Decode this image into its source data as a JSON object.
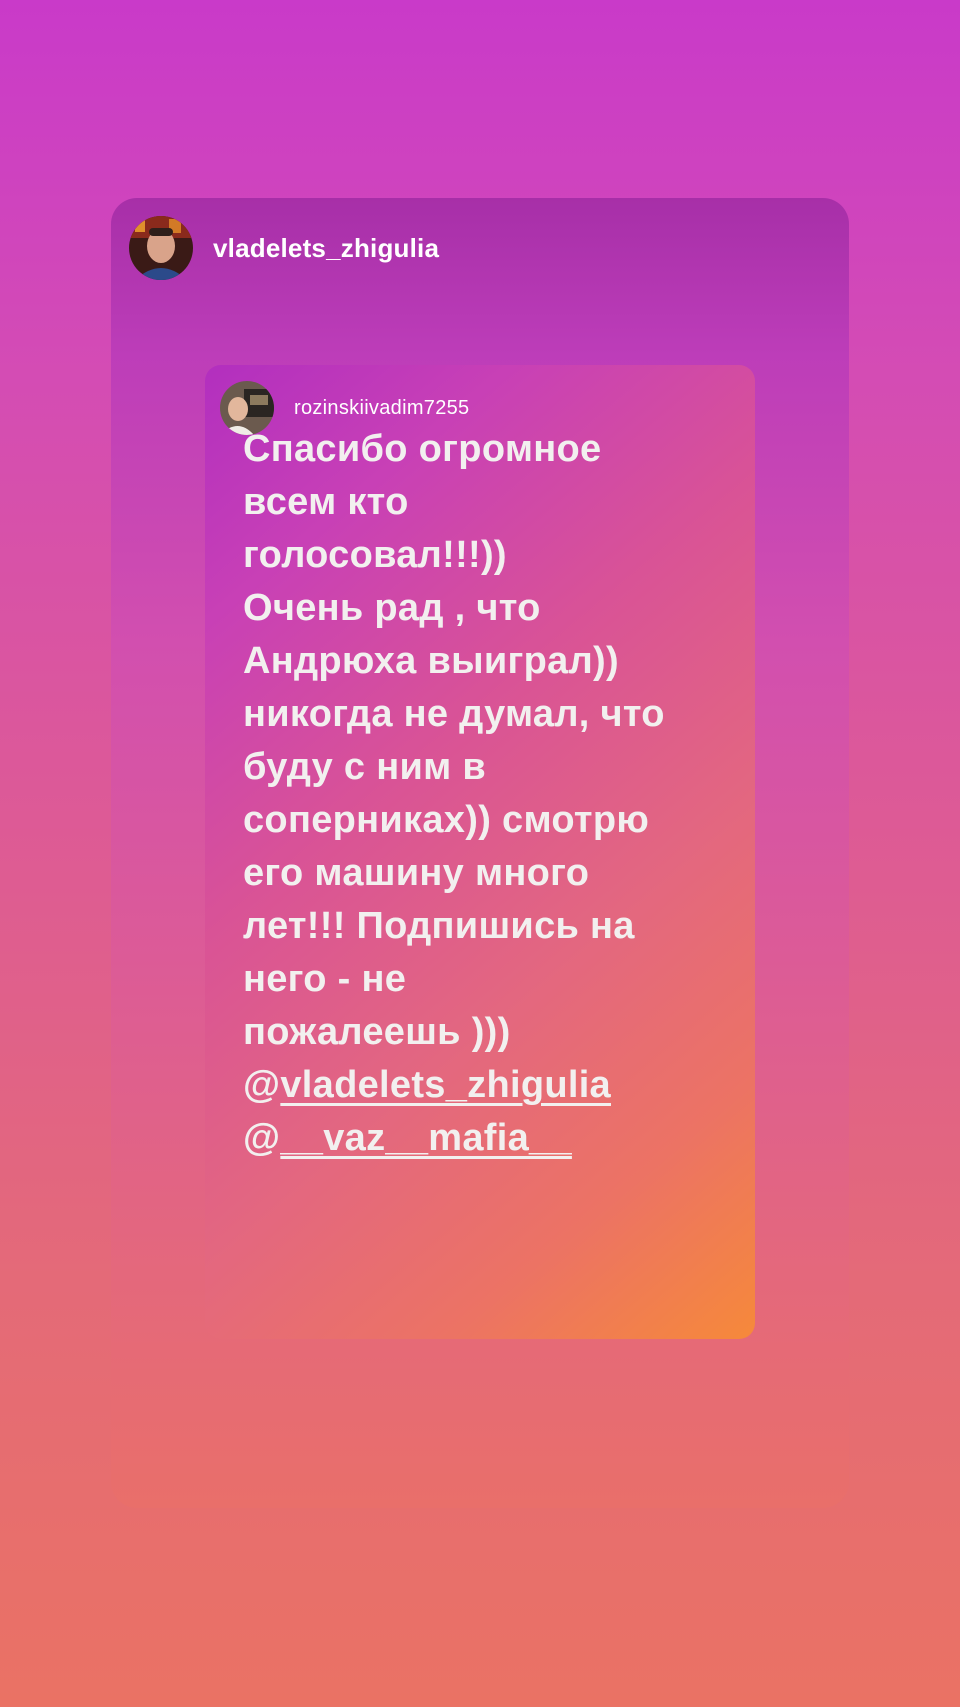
{
  "story": {
    "author": {
      "username": "vladelets_zhigulia"
    },
    "reposted_post": {
      "author": {
        "username": "rozinskiivadim7255"
      },
      "text_lines": [
        "Спасибо огромное",
        "всем кто",
        "голосовал!!!))",
        "Очень рад , что",
        "Андрюха выиграл))",
        "никогда не думал, что",
        "буду с ним в",
        "соперниках)) смотрю",
        "его машину много",
        "лет!!! Подпишись на",
        "него - не",
        "пожалеешь )))"
      ],
      "mentions": [
        {
          "at": "@",
          "name": "vladelets_zhigulia"
        },
        {
          "at": "@",
          "name": "__vaz__mafia__"
        }
      ]
    }
  },
  "colors": {
    "background_top": "#c93ac9",
    "background_bottom": "#ea7264",
    "inner_gradient_end": "#f6893a",
    "text": "#f2f0ef"
  },
  "icons": {
    "main_avatar": "avatar-photo",
    "inner_avatar": "avatar-photo"
  }
}
